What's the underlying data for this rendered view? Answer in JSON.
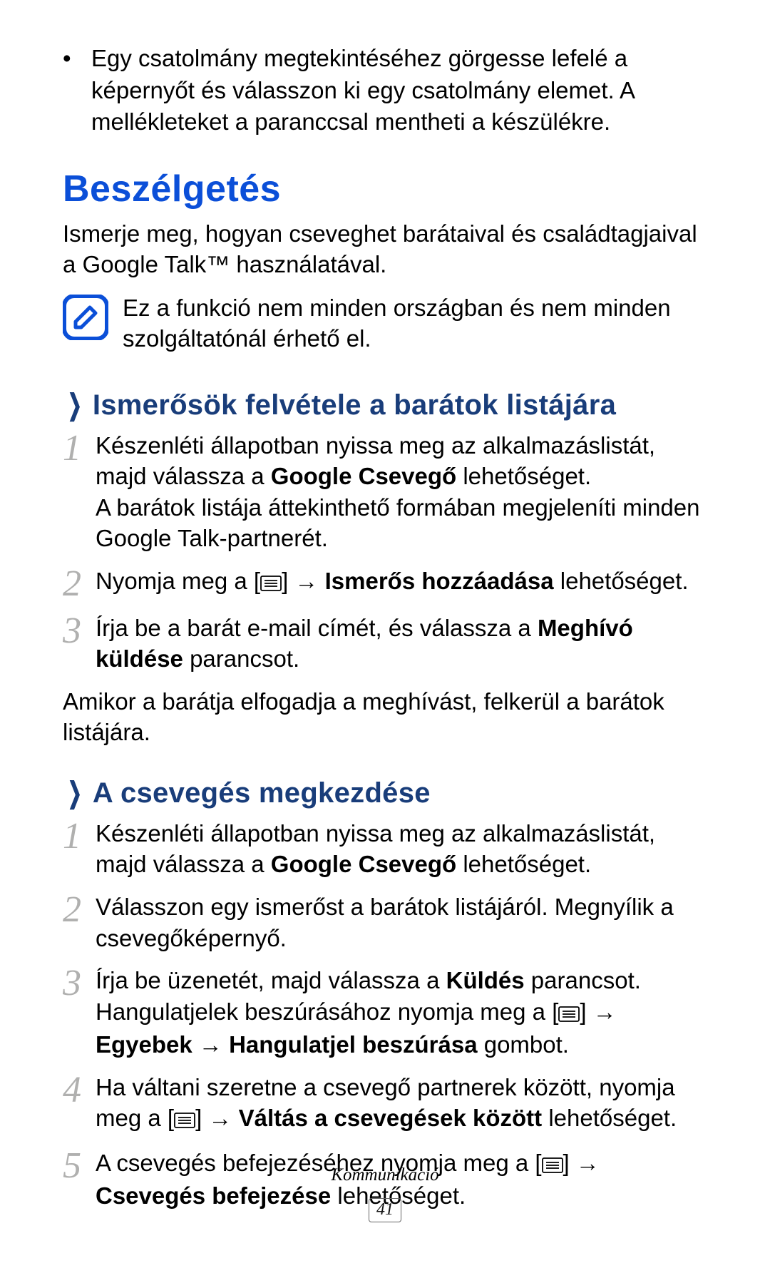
{
  "top_bullet": {
    "marker": "•",
    "text": "Egy csatolmány megtekintéséhez görgesse lefelé a képernyőt és válasszon ki egy csatolmány elemet. A mellékleteket a paranccsal mentheti a készülékre."
  },
  "title": "Beszélgetés",
  "intro": "Ismerje meg, hogyan cseveghet barátaival és családtagjaival a Google Talk™ használatával.",
  "note": "Ez a funkció nem minden országban és nem minden szolgáltatónál érhető el.",
  "section1": {
    "heading": "Ismerősök felvétele a barátok listájára",
    "step1_a": "Készenléti állapotban nyissa meg az alkalmazáslistát, majd válassza a ",
    "step1_b": "Google Csevegő",
    "step1_c": " lehetőséget.",
    "step1_d": "A barátok listája áttekinthető formában megjeleníti minden Google Talk-partnerét.",
    "step2_a": "Nyomja meg a [",
    "step2_b": "] → ",
    "step2_c": "Ismerős hozzáadása",
    "step2_d": " lehetőséget.",
    "step3_a": "Írja be a barát e-mail címét, és válassza a ",
    "step3_b": "Meghívó küldése",
    "step3_c": " parancsot.",
    "after": "Amikor a barátja elfogadja a meghívást, felkerül a barátok listájára."
  },
  "section2": {
    "heading": "A csevegés megkezdése",
    "step1_a": "Készenléti állapotban nyissa meg az alkalmazáslistát, majd válassza a ",
    "step1_b": "Google Csevegő",
    "step1_c": " lehetőséget.",
    "step2": "Válasszon egy ismerőst a barátok listájáról. Megnyílik a csevegőképernyő.",
    "step3_a": "Írja be üzenetét, majd válassza a ",
    "step3_b": "Küldés",
    "step3_c": " parancsot.",
    "step3_d": "Hangulatjelek beszúrásához nyomja meg a [",
    "step3_e": "] → ",
    "step3_f": "Egyebek",
    "step3_g": " → ",
    "step3_h": "Hangulatjel beszúrása",
    "step3_i": " gombot.",
    "step4_a": "Ha váltani szeretne a csevegő partnerek között, nyomja meg a [",
    "step4_b": "] → ",
    "step4_c": "Váltás a csevegések között",
    "step4_d": " lehetőséget.",
    "step5_a": "A csevegés befejezéséhez nyomja meg a [",
    "step5_b": "] → ",
    "step5_c": "Csevegés befejezése",
    "step5_d": " lehetőséget."
  },
  "nums": {
    "n1": "1",
    "n2": "2",
    "n3": "3",
    "n4": "4",
    "n5": "5"
  },
  "footer": {
    "label": "Kommunikáció",
    "page": "41"
  }
}
